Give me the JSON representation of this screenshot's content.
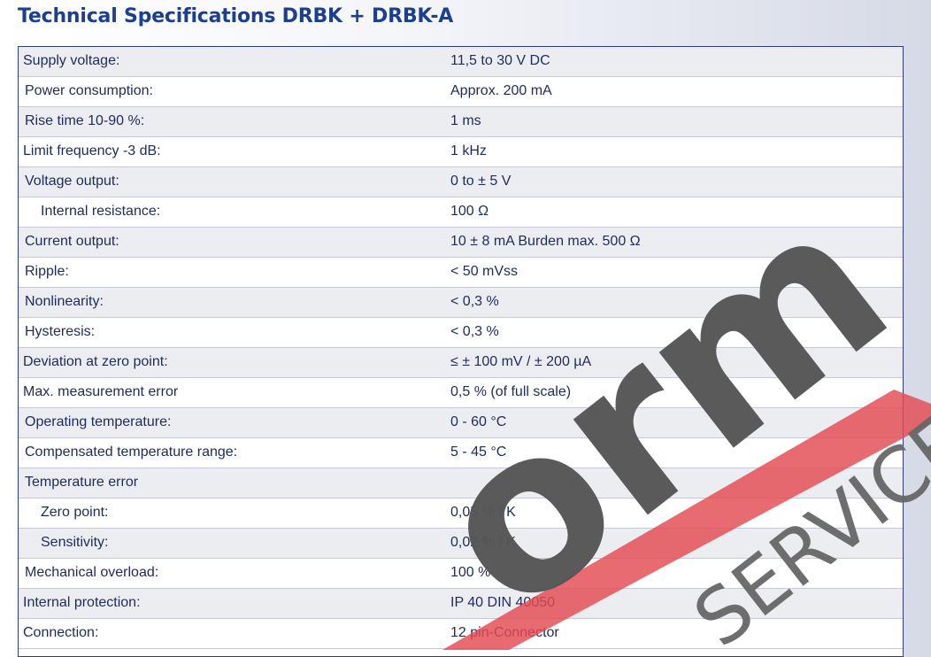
{
  "title": "Technical Specifications DRBK + DRBK-A",
  "specs": [
    {
      "label": "Supply voltage:",
      "value": "11,5 to 30 V DC",
      "indent": 0
    },
    {
      "label": "Power consumption:",
      "value": "Approx. 200 mA",
      "indent": 1
    },
    {
      "label": "Rise time 10-90 %:",
      "value": "1 ms",
      "indent": 1
    },
    {
      "label": "Limit frequency -3 dB:",
      "value": "1 kHz",
      "indent": 0
    },
    {
      "label": "Voltage output:",
      "value": "0 to ± 5 V",
      "indent": 1
    },
    {
      "label": "Internal resistance:",
      "value": "100 Ω",
      "indent": 2
    },
    {
      "label": "Current output:",
      "value": "10 ± 8 mA   Burden max. 500 Ω",
      "indent": 1
    },
    {
      "label": "Ripple:",
      "value": "< 50 mVss",
      "indent": 1
    },
    {
      "label": "Nonlinearity:",
      "value": "< 0,3 %",
      "indent": 1
    },
    {
      "label": "Hysteresis:",
      "value": "< 0,3 %",
      "indent": 1
    },
    {
      "label": "Deviation at zero point:",
      "value": "≤ ± 100 mV / ± 200 µA",
      "indent": 0
    },
    {
      "label": "Max. measurement error",
      "value": "0,5 % (of full scale)",
      "indent": 0
    },
    {
      "label": "Operating temperature:",
      "value": "0 - 60 °C",
      "indent": 1
    },
    {
      "label": "Compensated temperature range:",
      "value": "5 - 45 °C",
      "indent": 1
    },
    {
      "label": "Temperature error",
      "value": "",
      "indent": 1
    },
    {
      "label": "Zero point:",
      "value": "0,05 % / K",
      "indent": 2
    },
    {
      "label": "Sensitivity:",
      "value": "0,02 % / K",
      "indent": 2
    },
    {
      "label": "Mechanical overload:",
      "value": "100 %",
      "indent": 1
    },
    {
      "label": "Internal protection:",
      "value": "IP 40 DIN 40050",
      "indent": 0
    },
    {
      "label": "Connection:",
      "value": "12 pin-Connector",
      "indent": 0
    }
  ],
  "watermark": {
    "text_main": "orm",
    "text_sub": "SERVICE",
    "colors": {
      "main": "#555555",
      "sub": "#666666",
      "stripe": "#e34a52"
    }
  },
  "colors": {
    "title": "#1d3f8f",
    "border": "#2e3a8c",
    "text": "#1e2b5c",
    "row_alt": "#ecedf1"
  }
}
